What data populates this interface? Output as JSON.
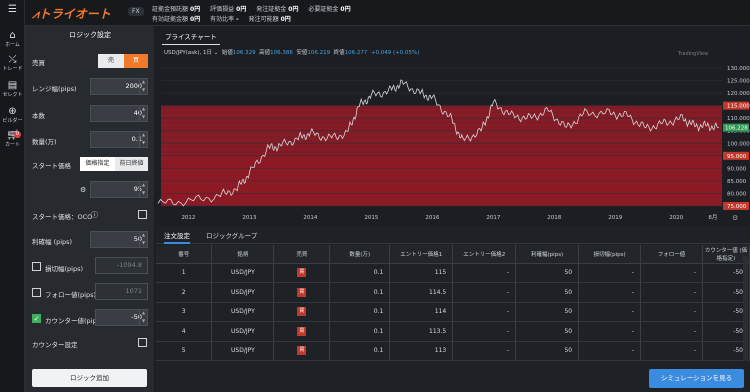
{
  "brand": "トライオート",
  "header": {
    "product": "FX",
    "row1": [
      {
        "label": "証拠金預託額",
        "value": "0円"
      },
      {
        "label": "評価損益",
        "value": "0円"
      },
      {
        "label": "発注証拠金",
        "value": "0円"
      },
      {
        "label": "必要証拠金",
        "value": "0円"
      }
    ],
    "row2": [
      {
        "label": "有効証拠金額",
        "value": "0円"
      },
      {
        "label": "有効比率",
        "value": "-"
      },
      {
        "label": "発注可能額",
        "value": "0円"
      }
    ]
  },
  "nav": {
    "home": "ホーム",
    "trade": "トレード",
    "select": "セレクト",
    "builder": "ビルダー",
    "cart": "カート",
    "cart_count": "0"
  },
  "logic": {
    "title": "ロジック設定",
    "side_label": "売買",
    "sell": "売",
    "buy": "買",
    "range_label": "レンジ幅(pips)",
    "range_value": "2000",
    "count_label": "本数",
    "count_value": "40",
    "qty_label": "数量(万)",
    "qty_value": "0.1",
    "start_label": "スタート価格",
    "start_fixed": "価格指定",
    "start_prev": "前日終値",
    "start_value": "95",
    "oco_label": "スタート価格：OCO",
    "profit_label": "利確幅 (pips)",
    "profit_value": "50",
    "stop_label": "損切幅(pips)",
    "stop_value": "-1094.8",
    "follow_label": "フォロー値(pips)",
    "follow_value": "1071",
    "counter_label": "カウンター値(pips)",
    "counter_value": "-50",
    "counter_setting_label": "カウンター設定",
    "add_button": "ロジック追加"
  },
  "chart": {
    "tab": "プライスチャート",
    "symbol": "USD/JPY(ask), 1日",
    "open_label": "始値",
    "open": "106.329",
    "high_label": "高値",
    "high": "106.386",
    "low_label": "安値",
    "low": "106.219",
    "close_label": "終値",
    "close": "106.277",
    "change": "+0.049 (+0.05%)",
    "watermark": "TradingView",
    "current_price": "106.228",
    "colors": {
      "band": "#8b1a24",
      "line": "#d7d9dc",
      "current": "#2e9b55",
      "highlight": "#c0392b"
    }
  },
  "chart_data": {
    "type": "line",
    "x_ticks": [
      "2012",
      "2013",
      "2014",
      "2015",
      "2016",
      "2017",
      "2018",
      "2019",
      "2020",
      "8月"
    ],
    "y_ticks": [
      130,
      125,
      120,
      115,
      110,
      105,
      100,
      95,
      90,
      85,
      80,
      75
    ],
    "y_highlight": [
      115,
      95,
      75
    ],
    "ylim": [
      73,
      132
    ],
    "band_ranges": [
      [
        95,
        115
      ],
      [
        75,
        95
      ]
    ],
    "x": [
      2011.5,
      2012.0,
      2012.5,
      2012.8,
      2013.0,
      2013.3,
      2013.5,
      2013.8,
      2014.0,
      2014.3,
      2014.6,
      2014.8,
      2015.0,
      2015.3,
      2015.5,
      2015.8,
      2016.0,
      2016.3,
      2016.5,
      2016.8,
      2017.0,
      2017.3,
      2017.6,
      2017.9,
      2018.2,
      2018.5,
      2018.9,
      2019.2,
      2019.5,
      2019.8,
      2020.1,
      2020.3,
      2020.5,
      2020.7
    ],
    "y": [
      76,
      77,
      79,
      82,
      88,
      98,
      99,
      102,
      104,
      102,
      104,
      115,
      119,
      121,
      124,
      120,
      118,
      110,
      101,
      105,
      116,
      111,
      110,
      113,
      106,
      112,
      112,
      111,
      106,
      108,
      110,
      107,
      107,
      106.2
    ]
  },
  "orders": {
    "tab_active": "注文設定",
    "tab_group": "ロジックグループ",
    "columns": [
      "番号",
      "銘柄",
      "売買",
      "数量(万)",
      "エントリー価格1",
      "エントリー価格2",
      "利確幅(pips)",
      "損切幅(pips)",
      "フォロー値",
      "カウンター値 (価格指定)"
    ],
    "rows": [
      {
        "no": "1",
        "symbol": "USD/JPY",
        "side": "買",
        "qty": "0.1",
        "entry1": "115",
        "entry2": "-",
        "profit": "50",
        "stop": "-",
        "follow": "-",
        "counter": "-50"
      },
      {
        "no": "2",
        "symbol": "USD/JPY",
        "side": "買",
        "qty": "0.1",
        "entry1": "114.5",
        "entry2": "-",
        "profit": "50",
        "stop": "-",
        "follow": "-",
        "counter": "-50"
      },
      {
        "no": "3",
        "symbol": "USD/JPY",
        "side": "買",
        "qty": "0.1",
        "entry1": "114",
        "entry2": "-",
        "profit": "50",
        "stop": "-",
        "follow": "-",
        "counter": "-50"
      },
      {
        "no": "4",
        "symbol": "USD/JPY",
        "side": "買",
        "qty": "0.1",
        "entry1": "113.5",
        "entry2": "-",
        "profit": "50",
        "stop": "-",
        "follow": "-",
        "counter": "-50"
      },
      {
        "no": "5",
        "symbol": "USD/JPY",
        "side": "買",
        "qty": "0.1",
        "entry1": "113",
        "entry2": "-",
        "profit": "50",
        "stop": "-",
        "follow": "-",
        "counter": "-50"
      }
    ],
    "simulate_button": "シミュレーションを見る"
  }
}
